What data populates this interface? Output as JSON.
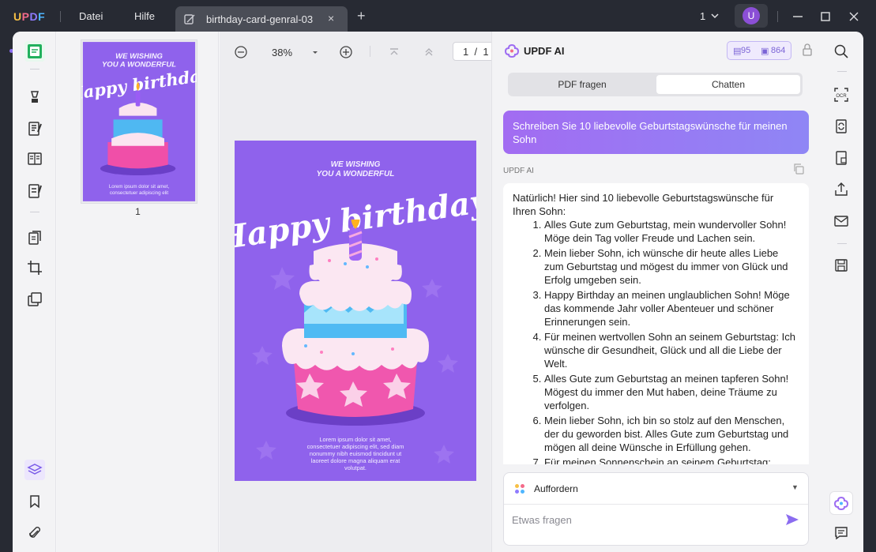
{
  "app": {
    "logo": "UPDF"
  },
  "menu": {
    "file": "Datei",
    "help": "Hilfe"
  },
  "tab": {
    "title": "birthday-card-genral-03",
    "close": "×"
  },
  "titlebar": {
    "page_count": "1",
    "avatar_initial": "U"
  },
  "viewer": {
    "zoom": "38%",
    "page_current": "1",
    "page_total_sep": "/",
    "page_total": "1"
  },
  "thumbnails": [
    {
      "page_number": "1"
    }
  ],
  "card": {
    "heading": [
      "WE WISHING",
      "YOU A WONDERFUL"
    ],
    "script_title": "Happy birthday",
    "body": [
      "Lorem ipsum dolor sit amet,",
      "consectetuer adipiscing elit, sed diam",
      "nonummy nibh euismod tincidunt ut",
      "laoreet dolore magna aliquam erat",
      "volutpat."
    ],
    "bg_color": "#8f62ec"
  },
  "ai": {
    "title": "UPDF AI",
    "credits_a": "95",
    "credits_b": "864",
    "tabs": [
      {
        "label": "PDF fragen",
        "active": false
      },
      {
        "label": "Chatten",
        "active": true
      }
    ],
    "user_message": "Schreiben Sie 10 liebevolle Geburtstagswünsche für meinen Sohn",
    "sender": "UPDF AI",
    "reply_intro": "Natürlich! Hier sind 10 liebevolle Geburtstagswünsche für Ihren Sohn:",
    "reply_items": [
      "Alles Gute zum Geburtstag, mein wundervoller Sohn! Möge dein Tag voller Freude und Lachen sein.",
      "Mein lieber Sohn, ich wünsche dir heute alles Liebe zum Geburtstag und mögest du immer von Glück und Erfolg umgeben sein.",
      "Happy Birthday an meinen unglaublichen Sohn! Möge das kommende Jahr voller Abenteuer und schöner Erinnerungen sein.",
      "Für meinen wertvollen Sohn an seinem Geburtstag: Ich wünsche dir Gesundheit, Glück und all die Liebe der Welt.",
      "Alles Gute zum Geburtstag an meinen tapferen Sohn! Mögest du immer den Mut haben, deine Träume zu verfolgen.",
      "Mein lieber Sohn, ich bin so stolz auf den Menschen, der du geworden bist. Alles Gute zum Geburtstag und mögen all deine Wünsche in Erfüllung gehen.",
      "Für meinen Sonnenschein an seinem Geburtstag: Möge"
    ],
    "prompt_label": "Auffordern",
    "ask_placeholder": "Etwas fragen",
    "accent": "#8b6cf0"
  }
}
